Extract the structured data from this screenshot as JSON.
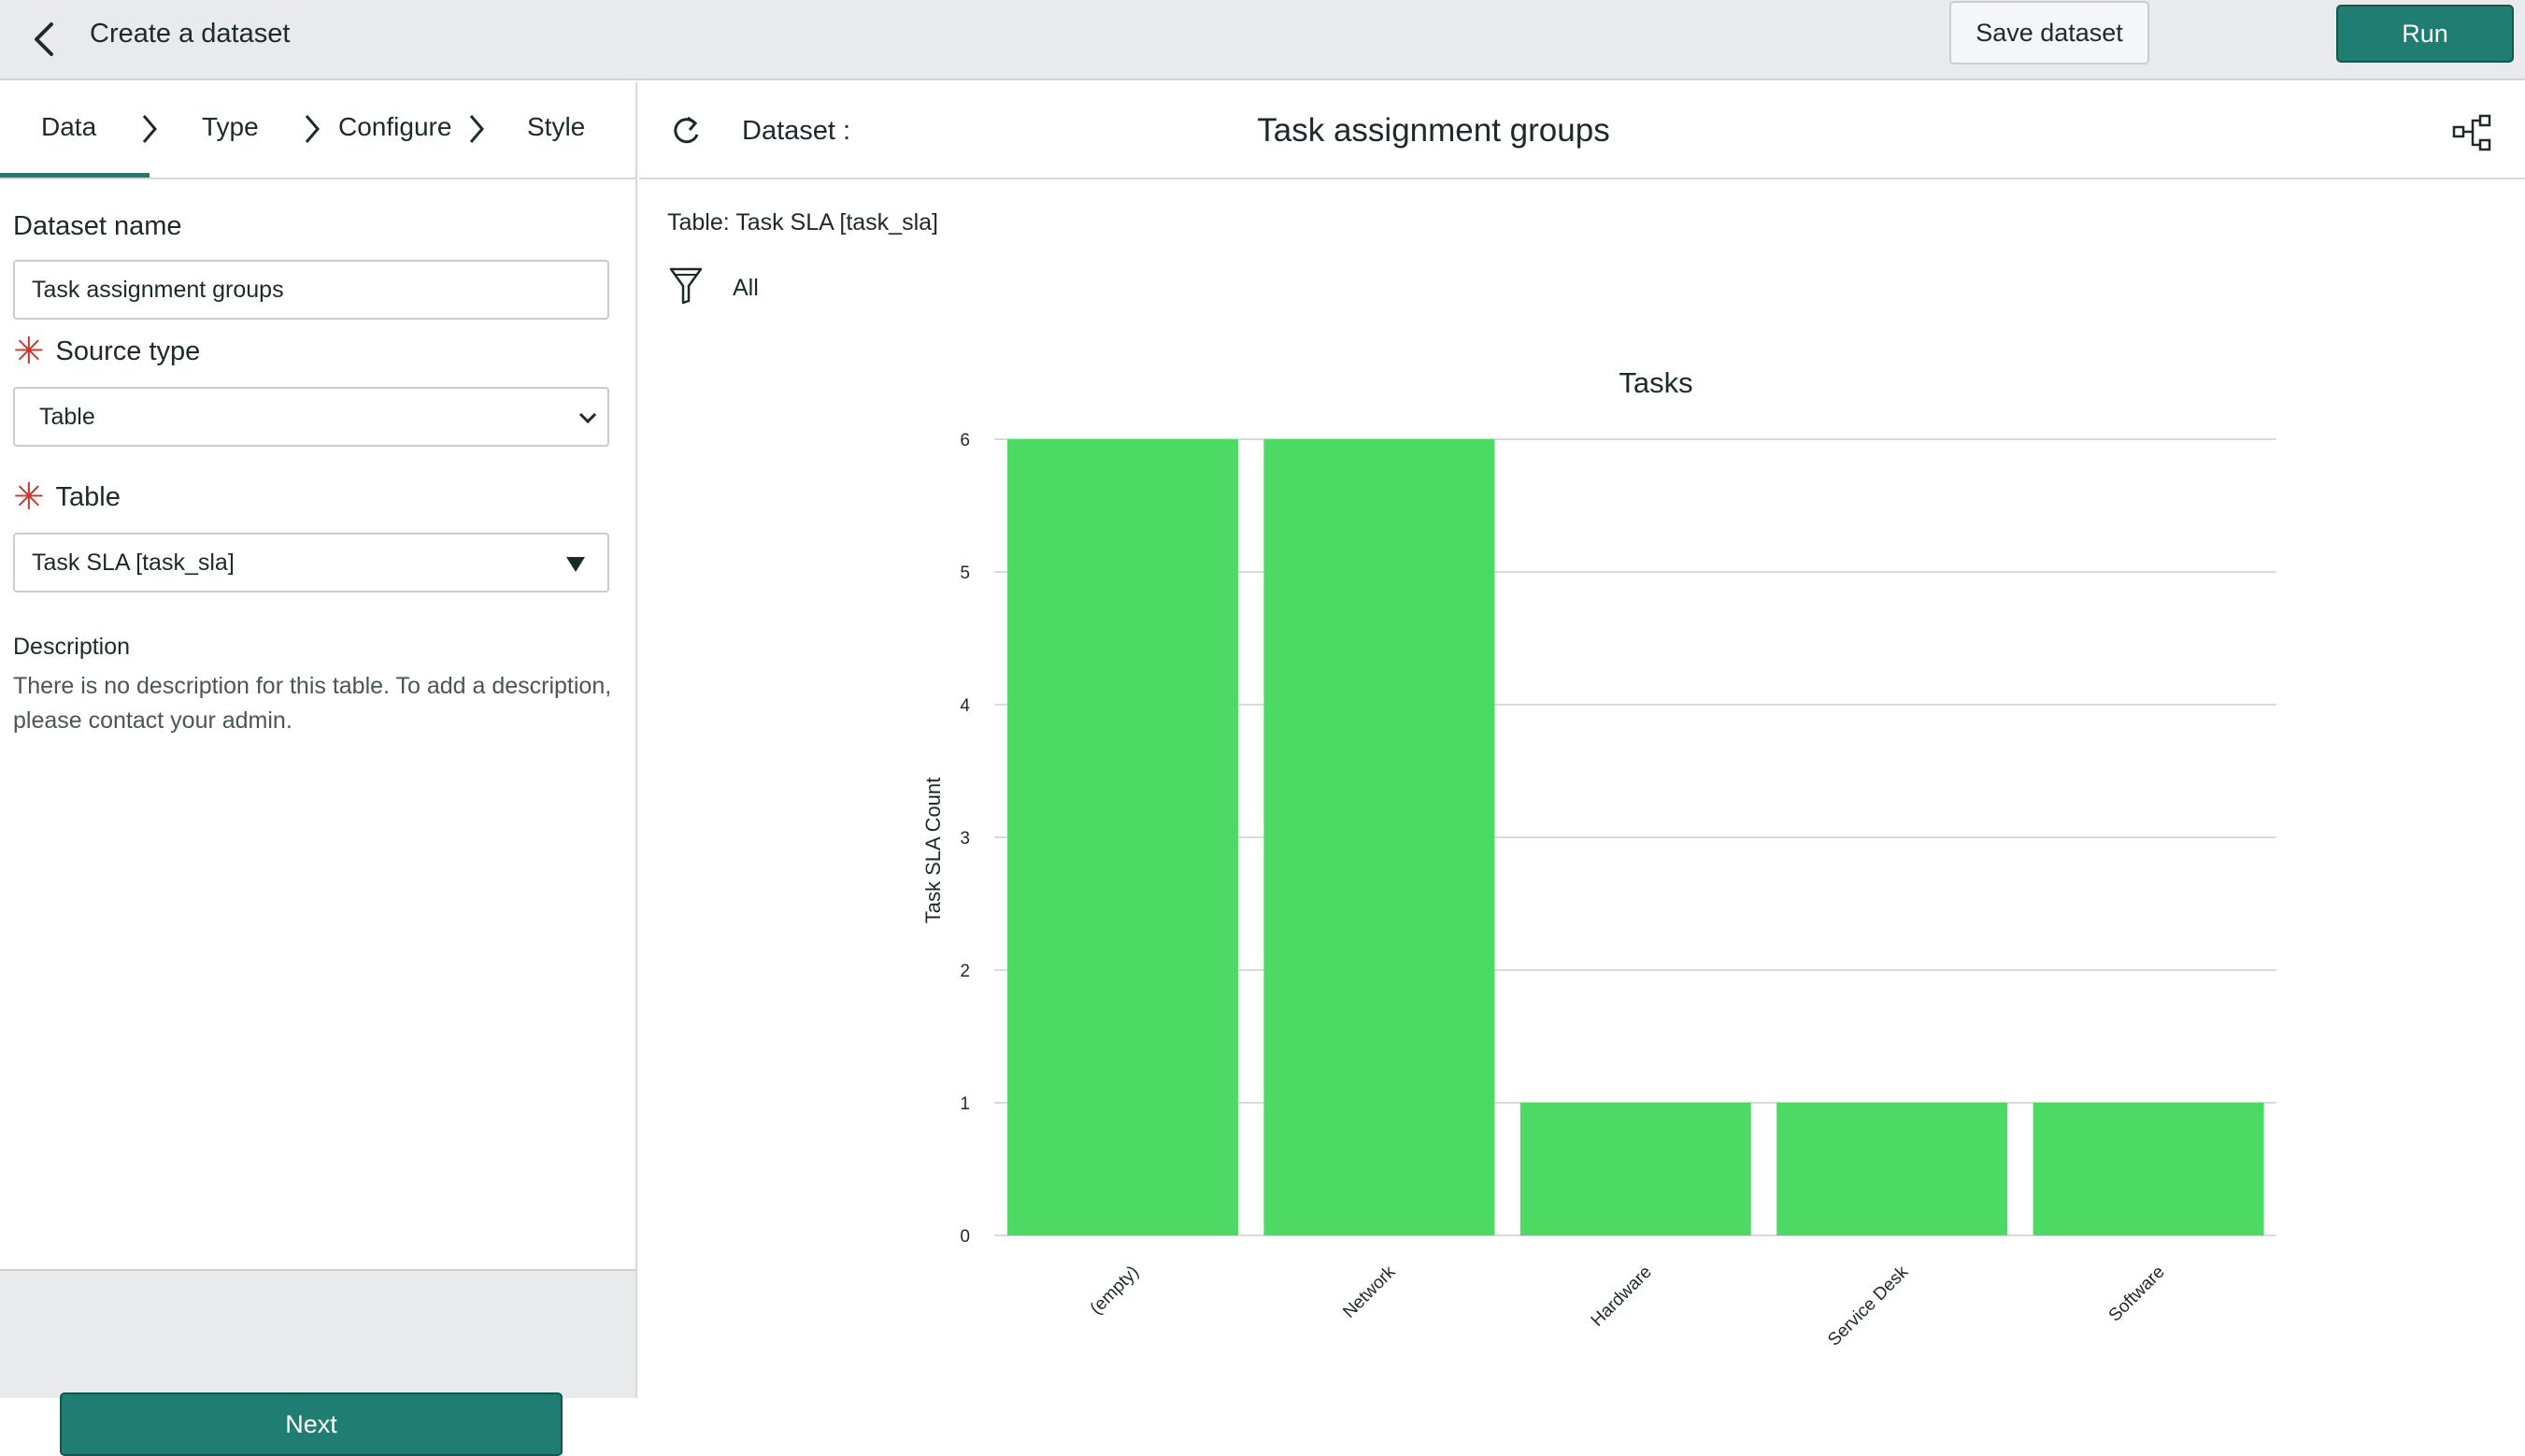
{
  "header": {
    "title": "Create a dataset",
    "save_label": "Save dataset",
    "run_label": "Run"
  },
  "steps": [
    {
      "label": "Data",
      "active": true
    },
    {
      "label": "Type",
      "active": false
    },
    {
      "label": "Configure",
      "active": false
    },
    {
      "label": "Style",
      "active": false
    }
  ],
  "form": {
    "dataset_name_label": "Dataset name",
    "dataset_name_value": "Task assignment groups",
    "source_type_label": "Source type",
    "source_type_value": "Table",
    "table_label": "Table",
    "table_value": "Task SLA [task_sla]",
    "description_title": "Description",
    "description_text": "There is no description for this table. To add a description, please contact your admin."
  },
  "footer": {
    "next_label": "Next"
  },
  "preview": {
    "dataset_label": "Dataset :",
    "dataset_name": "Task assignment groups",
    "table_info": "Table: Task SLA [task_sla]",
    "filter_text": "All"
  },
  "colors": {
    "accent": "#1f7d72",
    "bar": "#4cd964",
    "required": "#c8372d"
  },
  "chart_data": {
    "type": "bar",
    "title": "Tasks",
    "xlabel": "",
    "ylabel": "Task SLA Count",
    "categories": [
      "(empty)",
      "Network",
      "Hardware",
      "Service Desk",
      "Software"
    ],
    "values": [
      6,
      6,
      1,
      1,
      1
    ],
    "ylim": [
      0,
      6
    ],
    "yticks": [
      0,
      1,
      2,
      3,
      4,
      5,
      6
    ],
    "grid": true,
    "legend": "none"
  }
}
